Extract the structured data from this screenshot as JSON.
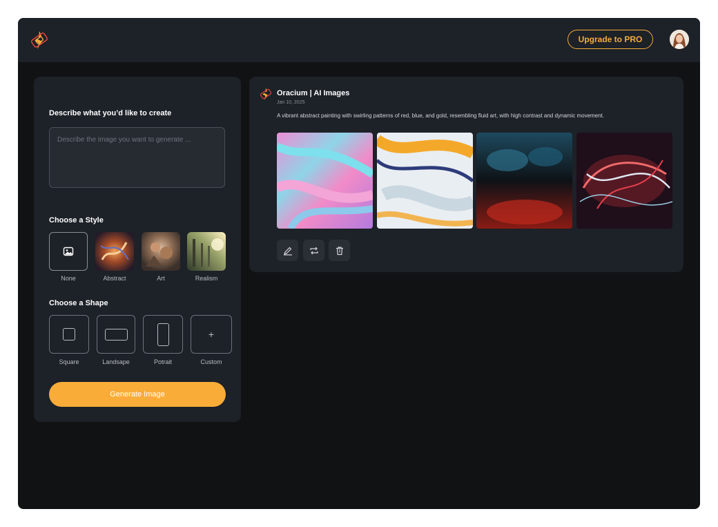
{
  "header": {
    "upgrade_label": "Upgrade to PRO",
    "logo_icon": "oracium-logo-icon",
    "avatar_icon": "user-avatar"
  },
  "create": {
    "prompt_title": "Describe what you’d like to create",
    "prompt_placeholder": "Describe the image you want to generate ...",
    "style_title": "Choose a Style",
    "styles": [
      "None",
      "Abstract",
      "Art",
      "Realism"
    ],
    "shape_title": "Choose a Shape",
    "shapes": [
      "Square",
      "Landsape",
      "Potrait",
      "Custom"
    ],
    "generate_label": "Generate Image"
  },
  "post": {
    "title": "Oracium | AI Images",
    "date": "Jan 10, 2025",
    "description": "A vibrant abstract painting with swirling patterns of red, blue, and gold, resembling fluid art, with high contrast and dynamic movement.",
    "actions": [
      "edit-icon",
      "repeat-icon",
      "trash-icon"
    ]
  },
  "colors": {
    "accent": "#f9ad38",
    "panel": "#1d2128",
    "background": "#111214"
  }
}
